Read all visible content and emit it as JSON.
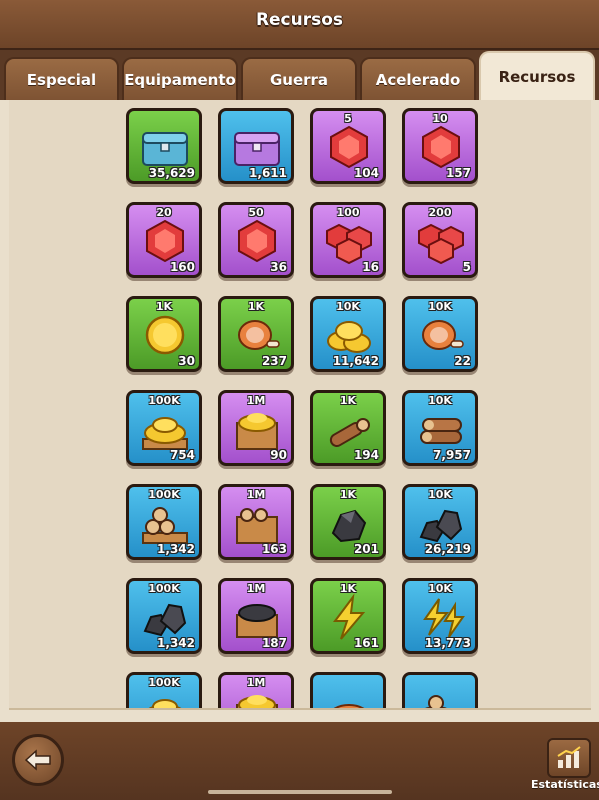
{
  "header": {
    "title": "Recursos"
  },
  "tabs": [
    {
      "label": "Especial",
      "active": false
    },
    {
      "label": "Equipamento",
      "active": false
    },
    {
      "label": "Guerra",
      "active": false
    },
    {
      "label": "Acelerado",
      "active": false
    },
    {
      "label": "Recursos",
      "active": true
    }
  ],
  "items": [
    {
      "icon": "chest-blue-icon",
      "color": "green",
      "amount": "",
      "count": "35,629"
    },
    {
      "icon": "chest-purple-icon",
      "color": "blue",
      "amount": "",
      "count": "1,611"
    },
    {
      "icon": "gem-icon",
      "color": "purple",
      "amount": "5",
      "count": "104"
    },
    {
      "icon": "gem-icon",
      "color": "purple",
      "amount": "10",
      "count": "157"
    },
    {
      "icon": "gem-icon",
      "color": "purple",
      "amount": "20",
      "count": "160"
    },
    {
      "icon": "gem-icon",
      "color": "purple",
      "amount": "50",
      "count": "36"
    },
    {
      "icon": "gem-pile-icon",
      "color": "purple",
      "amount": "100",
      "count": "16"
    },
    {
      "icon": "gem-pile-icon",
      "color": "purple",
      "amount": "200",
      "count": "5"
    },
    {
      "icon": "gold-coin-icon",
      "color": "green",
      "amount": "1K",
      "count": "30"
    },
    {
      "icon": "meat-icon",
      "color": "green",
      "amount": "1K",
      "count": "237"
    },
    {
      "icon": "gold-coins-icon",
      "color": "blue",
      "amount": "10K",
      "count": "11,642"
    },
    {
      "icon": "meat-icon",
      "color": "blue",
      "amount": "10K",
      "count": "22"
    },
    {
      "icon": "gold-pile-icon",
      "color": "blue",
      "amount": "100K",
      "count": "754"
    },
    {
      "icon": "gold-crate-icon",
      "color": "purple",
      "amount": "1M",
      "count": "90"
    },
    {
      "icon": "wood-log-icon",
      "color": "green",
      "amount": "1K",
      "count": "194"
    },
    {
      "icon": "wood-logs-icon",
      "color": "blue",
      "amount": "10K",
      "count": "7,957"
    },
    {
      "icon": "wood-pile-icon",
      "color": "blue",
      "amount": "100K",
      "count": "1,342"
    },
    {
      "icon": "wood-crate-icon",
      "color": "purple",
      "amount": "1M",
      "count": "163"
    },
    {
      "icon": "ore-icon",
      "color": "green",
      "amount": "1K",
      "count": "201"
    },
    {
      "icon": "ore-pile-icon",
      "color": "blue",
      "amount": "10K",
      "count": "26,219"
    },
    {
      "icon": "ore-pile-icon",
      "color": "blue",
      "amount": "100K",
      "count": "1,342"
    },
    {
      "icon": "ore-crate-icon",
      "color": "purple",
      "amount": "1M",
      "count": "187"
    },
    {
      "icon": "lightning-icon",
      "color": "green",
      "amount": "1K",
      "count": "161"
    },
    {
      "icon": "lightning-pile-icon",
      "color": "blue",
      "amount": "10K",
      "count": "13,773"
    },
    {
      "icon": "gold-pile-icon",
      "color": "blue",
      "amount": "100K",
      "count": ""
    },
    {
      "icon": "gold-crate-icon",
      "color": "purple",
      "amount": "1M",
      "count": ""
    },
    {
      "icon": "meat-pile-icon",
      "color": "blue",
      "amount": "",
      "count": ""
    },
    {
      "icon": "wood-pile-icon",
      "color": "blue",
      "amount": "",
      "count": ""
    }
  ],
  "footer": {
    "stats_label": "Estatísticas"
  }
}
